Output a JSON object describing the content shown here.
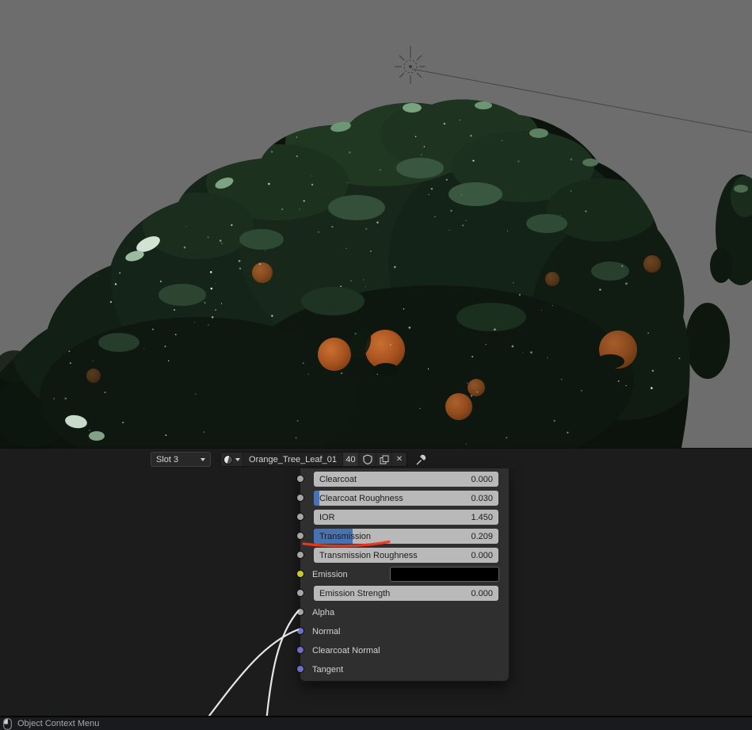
{
  "viewport": {
    "background": "#6d6d6d",
    "objects": [
      "sun-lamp",
      "orange-tree",
      "orange-fruits"
    ]
  },
  "editor_header": {
    "slot": {
      "label": "Slot 3"
    },
    "material": {
      "name": "Orange_Tree_Leaf_01",
      "users": "40",
      "unlink": "✕"
    }
  },
  "node": {
    "rows": [
      {
        "label": "Clearcoat",
        "value": "0.000",
        "fill": 0,
        "socket": "gray",
        "type": "slider"
      },
      {
        "label": "Clearcoat Roughness",
        "value": "0.030",
        "fill": 0.03,
        "socket": "gray",
        "type": "slider"
      },
      {
        "label": "IOR",
        "value": "1.450",
        "fill": 0,
        "socket": "gray",
        "type": "slider"
      },
      {
        "label": "Transmission",
        "value": "0.209",
        "fill": 0.209,
        "socket": "gray",
        "type": "slider",
        "annotated": true
      },
      {
        "label": "Transmission Roughness",
        "value": "0.000",
        "fill": 0,
        "socket": "gray",
        "type": "slider"
      },
      {
        "label": "Emission",
        "color_value": "#000000",
        "socket": "yellow",
        "type": "color"
      },
      {
        "label": "Emission Strength",
        "value": "0.000",
        "fill": 0,
        "socket": "gray",
        "type": "slider"
      },
      {
        "label": "Alpha",
        "socket": "gray",
        "type": "input"
      },
      {
        "label": "Normal",
        "socket": "purple",
        "type": "input"
      },
      {
        "label": "Clearcoat Normal",
        "socket": "purple",
        "type": "input"
      },
      {
        "label": "Tangent",
        "socket": "purple",
        "type": "input"
      }
    ]
  },
  "status_bar": {
    "label": "Object Context Menu"
  },
  "colors": {
    "slider_fill_blue": "#4772b3",
    "annotation_red": "#f1371b",
    "socket_gray": "#a5a5a5",
    "socket_yellow": "#c9c92f",
    "socket_purple": "#6e6ec9",
    "connection_line": "#e6e6e6"
  },
  "icons": {
    "material_preview": "sphere",
    "browse_dropdown": "chevron-down",
    "fake_user": "shield",
    "duplicate": "copy",
    "unlink": "x",
    "pin": "pushpin",
    "status_mouse": "mouse-left-click",
    "lamp": "sun"
  }
}
